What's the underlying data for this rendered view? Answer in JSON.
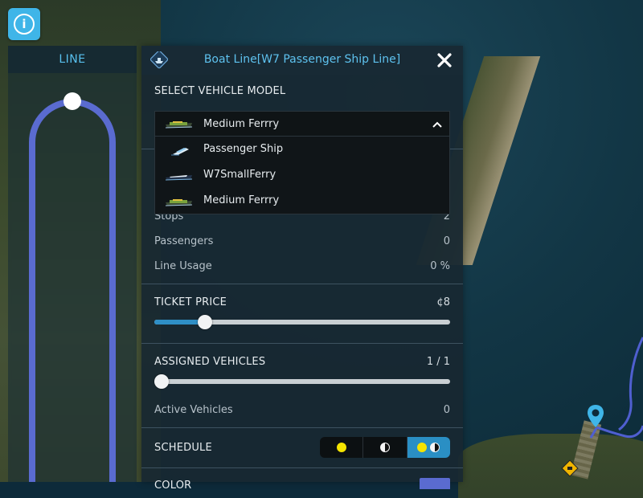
{
  "panel": {
    "title": "Boat Line[W7 Passenger Ship Line]",
    "icon": "boat-line-icon",
    "close_icon": "close-icon"
  },
  "line_panel": {
    "header": "LINE",
    "line_color": "#5a6bd0"
  },
  "vehicle_model": {
    "label": "SELECT VEHICLE MODEL",
    "selected": "Medium Ferrry",
    "options": [
      {
        "label": "Passenger Ship",
        "icon": "passenger-ship-icon"
      },
      {
        "label": "W7SmallFerry",
        "icon": "small-ferry-icon"
      },
      {
        "label": "Medium Ferrry",
        "icon": "medium-ferry-icon"
      }
    ]
  },
  "stats": {
    "stops_label": "Stops",
    "stops_value": "2",
    "passengers_label": "Passengers",
    "passengers_value": "0",
    "usage_label": "Line Usage",
    "usage_value": "0 %"
  },
  "ticket_price": {
    "label": "TICKET PRICE",
    "value": "¢8",
    "slider_fraction": 0.17
  },
  "assigned_vehicles": {
    "label": "ASSIGNED VEHICLES",
    "value": "1 / 1",
    "slider_fraction": 0.0,
    "active_label": "Active Vehicles",
    "active_value": "0"
  },
  "schedule": {
    "label": "SCHEDULE",
    "options": [
      "day",
      "night",
      "day-and-night"
    ],
    "selected": "day-and-night"
  },
  "color": {
    "label": "COLOR",
    "value": "#5a6bd0"
  },
  "colors": {
    "accent": "#5ec2ef",
    "selected_tab": "#2a8fc4",
    "info_button": "#3fb5e8",
    "route": "#4f5fd0"
  }
}
